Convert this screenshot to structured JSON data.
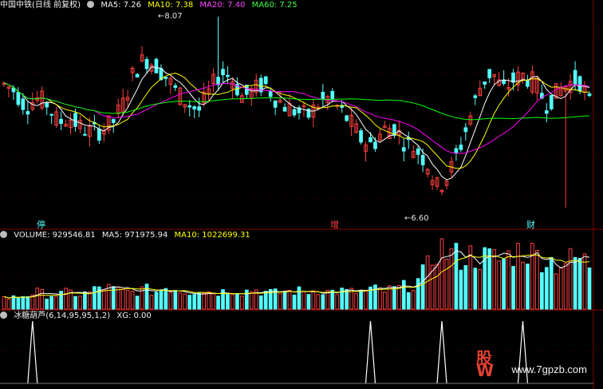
{
  "header_main": {
    "name": "中国中铁(日线 前复权)",
    "ma5": "MA5: 7.26",
    "ma10": "MA10: 7.38",
    "ma20": "MA20: 7.40",
    "ma60": "MA60: 7.25"
  },
  "header_volume": {
    "volume": "VOLUME: 929546.81",
    "ma5": "MA5: 971975.94",
    "ma10": "MA10: 1022699.31"
  },
  "header_indicator": {
    "name": "冰糖葫芦",
    "params": "(6,14,95,95,1,2)",
    "xg": "XG: 0.00"
  },
  "annotations": {
    "high_label": "8.07",
    "low_label": "6.60",
    "marker_1": "停",
    "marker_2": "增",
    "marker_3": "财"
  },
  "watermark": {
    "site": "www.7gpzb.com",
    "logo_text": "股W"
  },
  "colors": {
    "up": "#ff4040",
    "down": "#54ffff",
    "ma5": "#ffffff",
    "ma10": "#ffff00",
    "ma20": "#ff00ff",
    "ma60": "#00ff00",
    "grid": "#8b0000",
    "xg": "#ffffff"
  },
  "chart_data": {
    "type": "candlestick",
    "title": "中国中铁(日线 前复权)",
    "y_range_price": [
      6.55,
      8.1
    ],
    "bar_count": 124,
    "high": 8.07,
    "low": 6.6,
    "series": [
      {
        "name": "MA5",
        "last": 7.26
      },
      {
        "name": "MA10",
        "last": 7.38
      },
      {
        "name": "MA20",
        "last": 7.4
      },
      {
        "name": "MA60",
        "last": 7.25
      }
    ],
    "price_anchors": [
      7.55,
      7.5,
      7.38,
      7.44,
      7.4,
      7.25,
      7.3,
      7.22,
      7.18,
      7.2,
      7.25,
      7.4,
      7.65,
      7.75,
      7.7,
      7.6,
      7.48,
      7.4,
      7.35,
      7.5,
      7.65,
      7.6,
      7.45,
      7.5,
      7.56,
      7.45,
      7.38,
      7.34,
      7.3,
      7.4,
      7.45,
      7.35,
      7.25,
      7.12,
      7.08,
      7.2,
      7.22,
      7.1,
      7.05,
      6.95,
      6.75,
      6.85,
      7.05,
      7.3,
      7.55,
      7.65,
      7.5,
      7.58,
      7.62,
      7.55,
      7.4,
      7.48,
      7.55,
      7.6,
      7.4
    ],
    "volume": {
      "name": "VOLUME",
      "last": 929546.81,
      "ma5": 971975.94,
      "ma10": 1022699.31,
      "anchors": [
        2,
        2,
        2.5,
        3,
        2.5,
        2.5,
        3,
        2.5,
        3,
        4,
        3.5,
        3,
        3,
        3.5,
        3,
        4,
        3.5,
        3,
        3.5,
        3,
        3,
        3.5,
        3,
        3.5,
        3,
        2.8,
        3,
        3.2,
        3,
        3.5,
        3,
        3.2,
        3,
        3,
        3.5,
        3.2,
        3.5,
        4,
        4.5,
        7,
        11,
        10,
        9,
        9.5,
        9,
        9,
        8.5,
        10,
        10.5,
        9.5,
        9,
        8,
        8.5,
        9,
        8
      ],
      "ylim": [
        0,
        12
      ]
    },
    "indicator": {
      "name": "冰糖葫芦",
      "params": [
        6,
        14,
        95,
        95,
        1,
        2
      ],
      "xg": 0.0,
      "signal_bars": [
        6,
        77,
        92,
        109
      ]
    }
  }
}
